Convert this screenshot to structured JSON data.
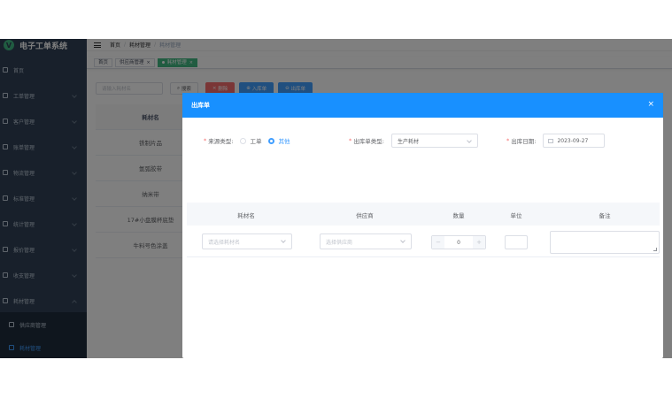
{
  "app": {
    "title": "电子工单系统",
    "logo_char": "V"
  },
  "sidebar": {
    "items": [
      {
        "label": "首页"
      },
      {
        "label": "工单管理"
      },
      {
        "label": "客户管理"
      },
      {
        "label": "账单管理"
      },
      {
        "label": "物流管理"
      },
      {
        "label": "标准管理"
      },
      {
        "label": "统计管理"
      },
      {
        "label": "报价管理"
      },
      {
        "label": "收支管理"
      },
      {
        "label": "耗材管理"
      }
    ],
    "sub_items": [
      {
        "label": "供应商管理"
      },
      {
        "label": "耗材管理"
      }
    ]
  },
  "navbar": {
    "breadcrumb": [
      "首页",
      "耗材管理",
      "耗材管理"
    ]
  },
  "tags": [
    {
      "label": "首页"
    },
    {
      "label": "供应商管理"
    },
    {
      "label": "耗材管理"
    }
  ],
  "toolbar": {
    "search_placeholder": "请输入耗材名",
    "search_label": "搜索",
    "delete_label": "删除",
    "inbound_label": "入库单",
    "outbound_label": "出库单"
  },
  "table": {
    "header": "耗材名",
    "rows": [
      "铁制片品",
      "氩弧胶带",
      "纳米带",
      "17#小盘膜杯底垫",
      "牛料号色涂盖"
    ]
  },
  "dialog": {
    "title": "出库单",
    "close": "×",
    "source_type_label": "来源类型:",
    "source_type_options": [
      "工单",
      "其他"
    ],
    "outbound_type_label": "出库单类型:",
    "outbound_type_value": "生产耗材",
    "outbound_date_label": "出库日期:",
    "outbound_date_value": "2023-09-27",
    "columns": [
      "耗材名",
      "供应商",
      "数量",
      "单位",
      "备注"
    ],
    "row": {
      "material_placeholder": "请选择耗材名",
      "supplier_placeholder": "选择供应商",
      "quantity": "0",
      "minus": "−",
      "plus": "+"
    }
  },
  "colors": {
    "sidebar_bg": "#304156",
    "primary": "#1890ff",
    "tag_active": "#42b983",
    "danger": "#f56c6c"
  }
}
